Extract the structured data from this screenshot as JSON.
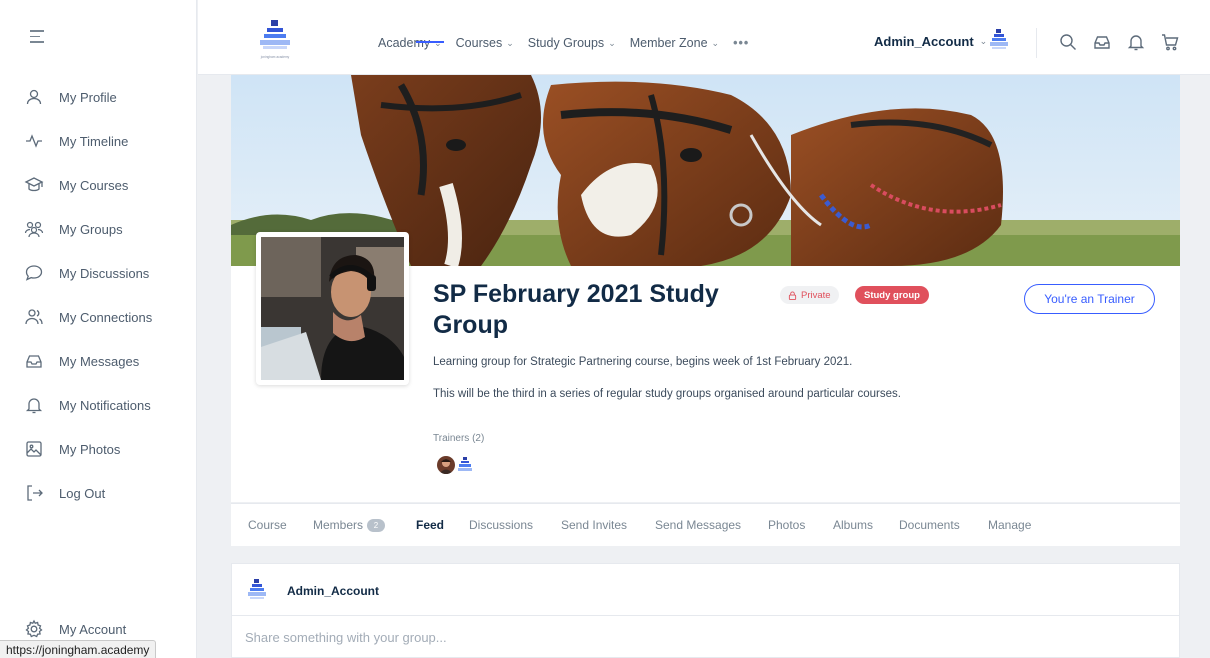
{
  "sidebar": {
    "items": [
      {
        "label": "My Profile",
        "icon": "user-icon"
      },
      {
        "label": "My Timeline",
        "icon": "activity-icon"
      },
      {
        "label": "My Courses",
        "icon": "graduation-cap-icon"
      },
      {
        "label": "My Groups",
        "icon": "groups-icon"
      },
      {
        "label": "My Discussions",
        "icon": "discussion-icon"
      },
      {
        "label": "My Connections",
        "icon": "connections-icon"
      },
      {
        "label": "My Messages",
        "icon": "inbox-icon"
      },
      {
        "label": "My Notifications",
        "icon": "bell-icon"
      },
      {
        "label": "My Photos",
        "icon": "photo-icon"
      },
      {
        "label": "Log Out",
        "icon": "logout-icon"
      }
    ],
    "account_label": "My Account"
  },
  "topnav": {
    "logo_text": "joningham academy",
    "menu": [
      {
        "label": "Academy",
        "has_dropdown": true
      },
      {
        "label": "Courses",
        "has_dropdown": true
      },
      {
        "label": "Study Groups",
        "has_dropdown": true
      },
      {
        "label": "Member Zone",
        "has_dropdown": true
      }
    ],
    "more": "•••",
    "account_name": "Admin_Account",
    "chevron": "⌄"
  },
  "group": {
    "title": "SP February 2021 Study Group",
    "privacy_badge": "Private",
    "type_badge": "Study group",
    "role_button": "You're an Trainer",
    "description": "Learning group for Strategic Partnering course, begins week of 1st February 2021.",
    "description_extra": "This will be the third in a series of regular study groups organised around particular courses.",
    "trainers_label": "Trainers (2)"
  },
  "tabs": [
    {
      "label": "Course"
    },
    {
      "label": "Members",
      "count": "2"
    },
    {
      "label": "Feed",
      "active": true
    },
    {
      "label": "Discussions"
    },
    {
      "label": "Send Invites"
    },
    {
      "label": "Send Messages"
    },
    {
      "label": "Photos"
    },
    {
      "label": "Albums"
    },
    {
      "label": "Documents"
    },
    {
      "label": "Manage"
    }
  ],
  "post": {
    "user": "Admin_Account",
    "placeholder": "Share something with your group..."
  },
  "status_url": "https://joningham.academy",
  "colors": {
    "accent": "#385dff",
    "danger": "#e0505c",
    "text": "#122b46",
    "muted": "#7a8793"
  }
}
